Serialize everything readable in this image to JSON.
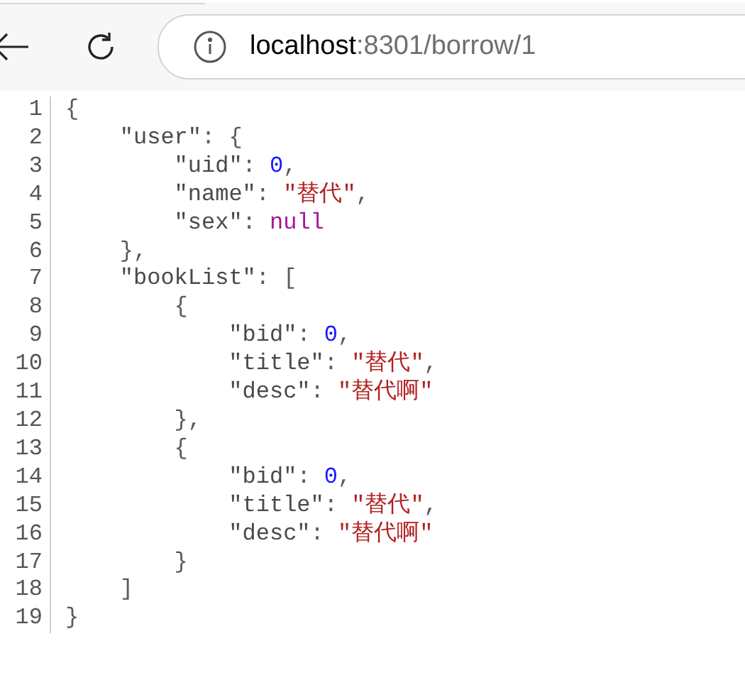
{
  "address_bar": {
    "host": "localhost",
    "path": ":8301/borrow/1"
  },
  "code": [
    {
      "number": "1",
      "tokens": [
        {
          "kind": "punct",
          "text": "{"
        }
      ],
      "children": [
        {
          "number": "2",
          "tokens": [
            {
              "kind": "key",
              "text": "\"user\""
            },
            {
              "kind": "punct",
              "text": ": {"
            }
          ],
          "children": [
            {
              "number": "3",
              "tokens": [
                {
                  "kind": "key",
                  "text": "\"uid\""
                },
                {
                  "kind": "punct",
                  "text": ": "
                },
                {
                  "kind": "number",
                  "text": "0"
                },
                {
                  "kind": "punct",
                  "text": ","
                }
              ]
            },
            {
              "number": "4",
              "tokens": [
                {
                  "kind": "key",
                  "text": "\"name\""
                },
                {
                  "kind": "punct",
                  "text": ": "
                },
                {
                  "kind": "string",
                  "text": "\"替代\""
                },
                {
                  "kind": "punct",
                  "text": ","
                }
              ]
            },
            {
              "number": "5",
              "tokens": [
                {
                  "kind": "key",
                  "text": "\"sex\""
                },
                {
                  "kind": "punct",
                  "text": ": "
                },
                {
                  "kind": "null",
                  "text": "null"
                }
              ]
            }
          ]
        },
        {
          "number": "6",
          "tokens": [
            {
              "kind": "punct",
              "text": "},"
            }
          ]
        },
        {
          "number": "7",
          "tokens": [
            {
              "kind": "key",
              "text": "\"bookList\""
            },
            {
              "kind": "punct",
              "text": ": ["
            }
          ],
          "children": [
            {
              "number": "8",
              "tokens": [
                {
                  "kind": "punct",
                  "text": "{"
                }
              ],
              "children": [
                {
                  "number": "9",
                  "tokens": [
                    {
                      "kind": "key",
                      "text": "\"bid\""
                    },
                    {
                      "kind": "punct",
                      "text": ": "
                    },
                    {
                      "kind": "number",
                      "text": "0"
                    },
                    {
                      "kind": "punct",
                      "text": ","
                    }
                  ]
                },
                {
                  "number": "10",
                  "tokens": [
                    {
                      "kind": "key",
                      "text": "\"title\""
                    },
                    {
                      "kind": "punct",
                      "text": ": "
                    },
                    {
                      "kind": "string",
                      "text": "\"替代\""
                    },
                    {
                      "kind": "punct",
                      "text": ","
                    }
                  ]
                },
                {
                  "number": "11",
                  "tokens": [
                    {
                      "kind": "key",
                      "text": "\"desc\""
                    },
                    {
                      "kind": "punct",
                      "text": ": "
                    },
                    {
                      "kind": "string",
                      "text": "\"替代啊\""
                    }
                  ]
                }
              ]
            },
            {
              "number": "12",
              "tokens": [
                {
                  "kind": "punct",
                  "text": "},"
                }
              ]
            },
            {
              "number": "13",
              "tokens": [
                {
                  "kind": "punct",
                  "text": "{"
                }
              ],
              "children": [
                {
                  "number": "14",
                  "tokens": [
                    {
                      "kind": "key",
                      "text": "\"bid\""
                    },
                    {
                      "kind": "punct",
                      "text": ": "
                    },
                    {
                      "kind": "number",
                      "text": "0"
                    },
                    {
                      "kind": "punct",
                      "text": ","
                    }
                  ]
                },
                {
                  "number": "15",
                  "tokens": [
                    {
                      "kind": "key",
                      "text": "\"title\""
                    },
                    {
                      "kind": "punct",
                      "text": ": "
                    },
                    {
                      "kind": "string",
                      "text": "\"替代\""
                    },
                    {
                      "kind": "punct",
                      "text": ","
                    }
                  ]
                },
                {
                  "number": "16",
                  "tokens": [
                    {
                      "kind": "key",
                      "text": "\"desc\""
                    },
                    {
                      "kind": "punct",
                      "text": ": "
                    },
                    {
                      "kind": "string",
                      "text": "\"替代啊\""
                    }
                  ]
                }
              ]
            },
            {
              "number": "17",
              "tokens": [
                {
                  "kind": "punct",
                  "text": "}"
                }
              ]
            }
          ]
        },
        {
          "number": "18",
          "tokens": [
            {
              "kind": "punct",
              "text": "]"
            }
          ]
        }
      ]
    },
    {
      "number": "19",
      "tokens": [
        {
          "kind": "punct",
          "text": "}"
        }
      ]
    }
  ]
}
